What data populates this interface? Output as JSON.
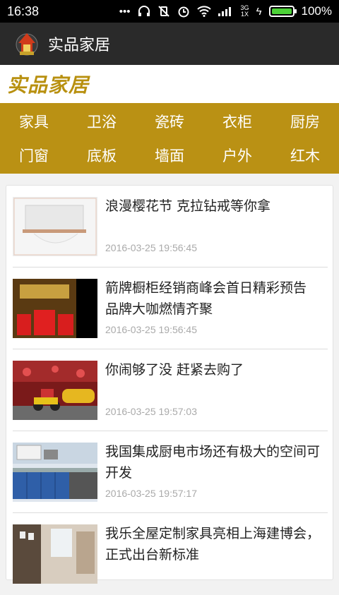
{
  "status_bar": {
    "time": "16:38",
    "network": "3G\n1X",
    "battery": "100%",
    "battery_level": 1.0
  },
  "app_bar": {
    "title": "实品家居",
    "logo_icon": "house-logo-icon"
  },
  "brand": {
    "text": "实品家居"
  },
  "categories": [
    "家具",
    "卫浴",
    "瓷砖",
    "衣柜",
    "厨房",
    "门窗",
    "底板",
    "墙面",
    "户外",
    "红木"
  ],
  "colors": {
    "accent": "#ba9114",
    "brand_text": "#b8900f",
    "app_bar": "#2a2a2a"
  },
  "articles": [
    {
      "title": "浪漫樱花节 克拉钻戒等你拿",
      "date": "2016-03-25 19:56:45"
    },
    {
      "title": "箭牌橱柜经销商峰会首日精彩预告 品牌大咖燃情齐聚",
      "date": "2016-03-25 19:56:45"
    },
    {
      "title": "你闹够了没 赶紧去购了",
      "date": "2016-03-25 19:57:03"
    },
    {
      "title": "我国集成厨电市场还有极大的空间可开发",
      "date": "2016-03-25 19:57:17"
    },
    {
      "title": "我乐全屋定制家具亮相上海建博会，正式出台新标准",
      "date": ""
    }
  ]
}
